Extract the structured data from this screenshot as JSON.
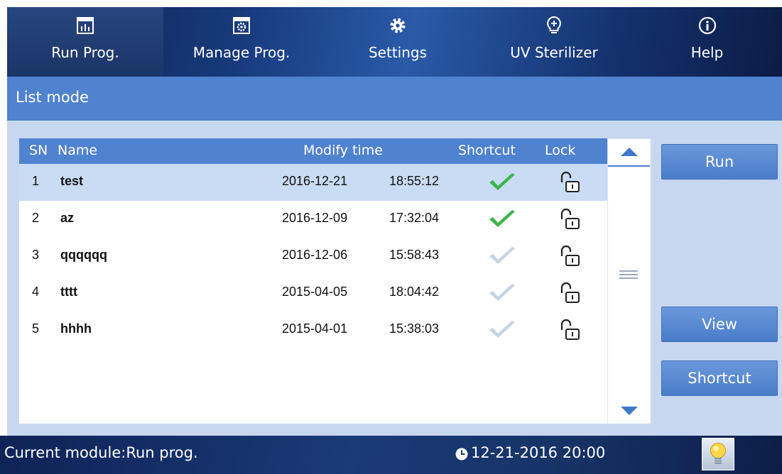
{
  "nav": {
    "tabs": [
      {
        "label": "Run Prog.",
        "icon": "bar-chart-icon",
        "active": true
      },
      {
        "label": "Manage Prog.",
        "icon": "gear-box-icon",
        "active": false
      },
      {
        "label": "Settings",
        "icon": "gear-icon",
        "active": false
      },
      {
        "label": "UV Sterilizer",
        "icon": "uv-bulb-icon",
        "active": false
      },
      {
        "label": "Help",
        "icon": "info-icon",
        "active": false
      }
    ]
  },
  "mode": {
    "label": "List mode"
  },
  "table": {
    "headers": {
      "sn": "SN",
      "name": "Name",
      "modify_time": "Modify time",
      "shortcut": "Shortcut",
      "lock": "Lock"
    },
    "rows": [
      {
        "sn": "1",
        "name": "test",
        "date": "2016-12-21",
        "time": "18:55:12",
        "shortcut": true,
        "locked": false,
        "selected": true
      },
      {
        "sn": "2",
        "name": "az",
        "date": "2016-12-09",
        "time": "17:32:04",
        "shortcut": true,
        "locked": false,
        "selected": false
      },
      {
        "sn": "3",
        "name": "qqqqqq",
        "date": "2016-12-06",
        "time": "15:58:43",
        "shortcut": false,
        "locked": false,
        "selected": false
      },
      {
        "sn": "4",
        "name": "tttt",
        "date": "2015-04-05",
        "time": "18:04:42",
        "shortcut": false,
        "locked": false,
        "selected": false
      },
      {
        "sn": "5",
        "name": "hhhh",
        "date": "2015-04-01",
        "time": "15:38:03",
        "shortcut": false,
        "locked": false,
        "selected": false
      }
    ]
  },
  "actions": {
    "run": "Run",
    "view": "View",
    "shortcut": "Shortcut"
  },
  "status": {
    "module": "Current module:Run prog.",
    "datetime": "12-21-2016 20:00"
  },
  "colors": {
    "accent": "#4f82cf",
    "check_on": "#3bb54a",
    "check_off": "#c5d3e2"
  }
}
